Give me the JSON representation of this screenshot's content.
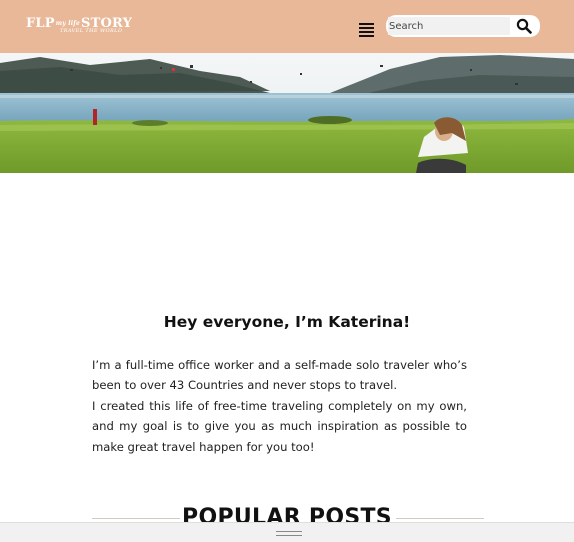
{
  "header": {
    "logo_left": "FLP",
    "logo_middle": "my life",
    "logo_right": "STORY",
    "logo_tagline": "TRAVEL THE WORLD",
    "background_color": "#e9b898"
  },
  "menu": {
    "icon": "hamburger-menu-icon"
  },
  "search": {
    "placeholder": "Search",
    "value": "",
    "icon": "search-icon"
  },
  "hero": {
    "alt_subject": "lake-landscape-with-woman"
  },
  "intro": {
    "title": "Hey everyone, I’m Katerina!",
    "paragraph_1": "I’m a full-time office worker and a self-made solo traveler who’s been to over 43 Countries and never stops to travel.",
    "paragraph_2": "I created this life of free-time traveling completely on my own, and my goal is to give you as much inspiration as possible to make great travel happen for you too!"
  },
  "popular": {
    "title": "POPULAR POSTS"
  },
  "bottom_bar": {
    "icon": "drag-handle-icon"
  }
}
